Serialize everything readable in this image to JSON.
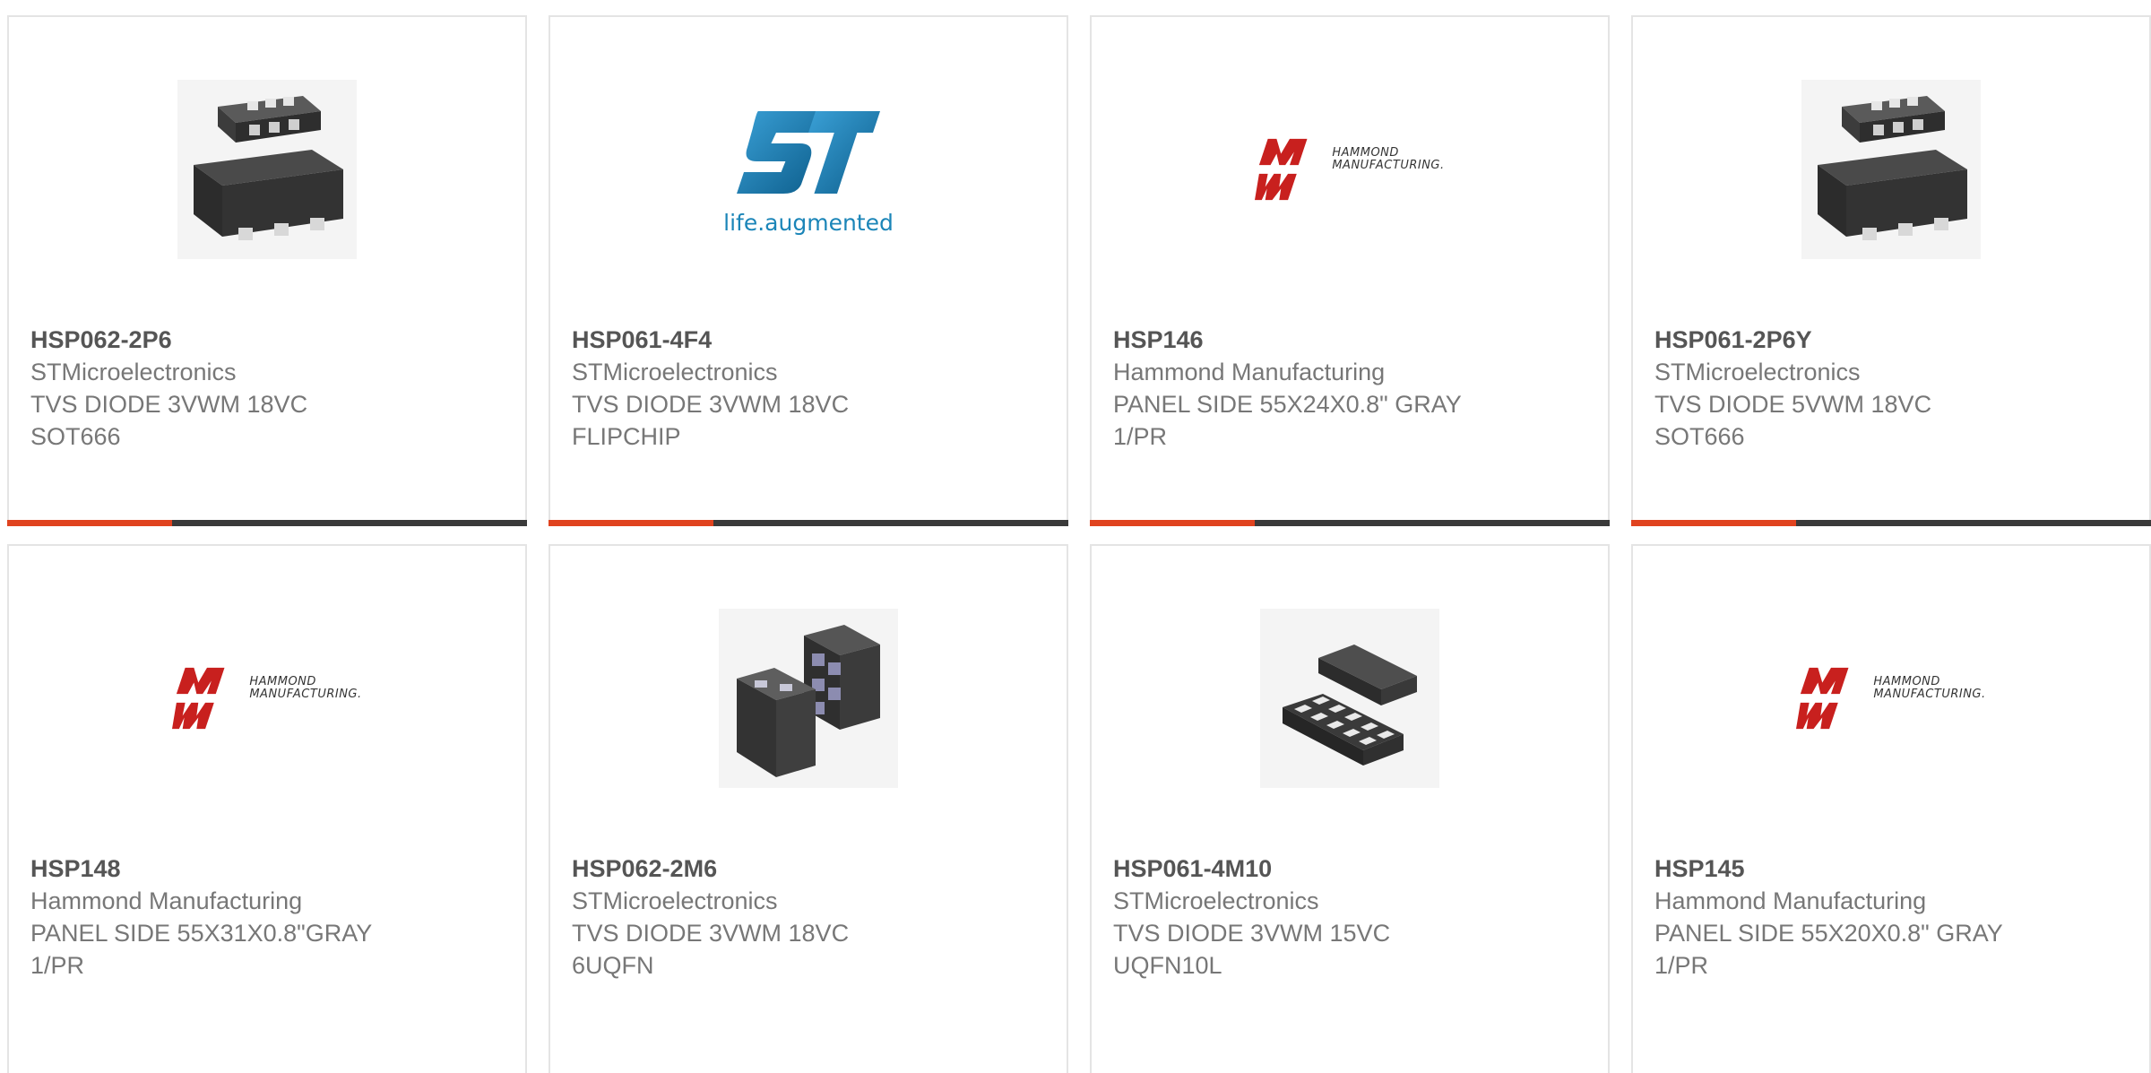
{
  "products": [
    {
      "part_number": "HSP062-2P6",
      "manufacturer": "STMicroelectronics",
      "description": "TVS DIODE 3VWM 18VC SOT666",
      "image": "sot666-package-image",
      "highlight_color": "#e0431f"
    },
    {
      "part_number": "HSP061-4F4",
      "manufacturer": "STMicroelectronics",
      "description": "TVS DIODE 3VWM 18VC FLIPCHIP",
      "image": "st-logo-image",
      "logo_tagline": "life.augmented",
      "highlight_color": "#e0431f"
    },
    {
      "part_number": "HSP146",
      "manufacturer": "Hammond Manufacturing",
      "description": "PANEL SIDE 55X24X0.8\" GRAY 1/PR",
      "image": "hammond-logo-image",
      "logo_text_line1": "HAMMOND",
      "logo_text_line2": "MANUFACTURING.",
      "highlight_color": "#e0431f"
    },
    {
      "part_number": "HSP061-2P6Y",
      "manufacturer": "STMicroelectronics",
      "description": "TVS DIODE 5VWM 18VC SOT666",
      "image": "sot666-package-image",
      "highlight_color": "#e0431f"
    },
    {
      "part_number": "HSP148",
      "manufacturer": "Hammond Manufacturing",
      "description": "PANEL SIDE 55X31X0.8\"GRAY 1/PR",
      "image": "hammond-logo-image",
      "logo_text_line1": "HAMMOND",
      "logo_text_line2": "MANUFACTURING."
    },
    {
      "part_number": "HSP062-2M6",
      "manufacturer": "STMicroelectronics",
      "description": "TVS DIODE 3VWM 18VC 6UQFN",
      "image": "uqfn6-package-image"
    },
    {
      "part_number": "HSP061-4M10",
      "manufacturer": "STMicroelectronics",
      "description": "TVS DIODE 3VWM 15VC UQFN10L",
      "image": "uqfn10-package-image"
    },
    {
      "part_number": "HSP145",
      "manufacturer": "Hammond Manufacturing",
      "description": "PANEL SIDE 55X20X0.8\" GRAY 1/PR",
      "image": "hammond-logo-image",
      "logo_text_line1": "HAMMOND",
      "logo_text_line2": "MANUFACTURING."
    }
  ],
  "colors": {
    "accent": "#e0431f",
    "bar_dark": "#3a3a3a",
    "st_blue": "#1b85b8",
    "hammond_red": "#c8201e",
    "text_gray": "#777777"
  }
}
